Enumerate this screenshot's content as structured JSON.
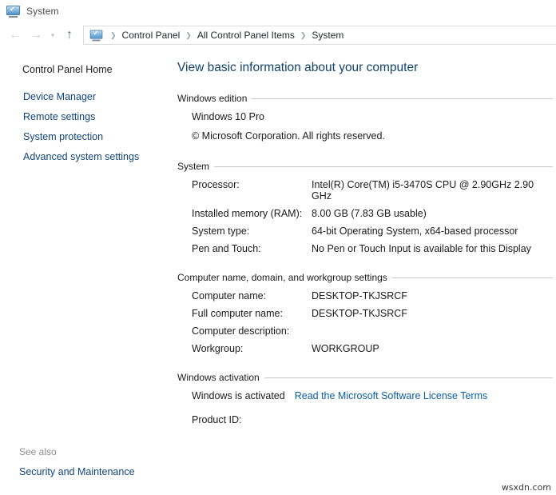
{
  "window": {
    "title": "System",
    "icon": "system-monitor-check-icon"
  },
  "addressbar": {
    "back_icon": "←",
    "forward_icon": "→",
    "recent_icon": "▾",
    "up_icon": "↑",
    "separator": "❯",
    "crumbs": [
      {
        "label": "Control Panel"
      },
      {
        "label": "All Control Panel Items"
      },
      {
        "label": "System"
      }
    ]
  },
  "sidebar": {
    "home_label": "Control Panel Home",
    "items": [
      {
        "label": "Device Manager",
        "icon": "uac-shield-icon"
      },
      {
        "label": "Remote settings",
        "icon": "uac-shield-icon"
      },
      {
        "label": "System protection",
        "icon": "uac-shield-icon"
      },
      {
        "label": "Advanced system settings",
        "icon": "uac-shield-icon"
      }
    ],
    "see_also": {
      "title": "See also",
      "links": [
        {
          "label": "Security and Maintenance"
        }
      ]
    }
  },
  "main": {
    "page_title": "View basic information about your computer",
    "sections": {
      "windows_edition": {
        "heading": "Windows edition",
        "edition": "Windows 10 Pro",
        "copyright": "© Microsoft Corporation. All rights reserved."
      },
      "system": {
        "heading": "System",
        "rows": [
          {
            "label": "Processor:",
            "value": "Intel(R) Core(TM) i5-3470S CPU @ 2.90GHz   2.90 GHz"
          },
          {
            "label": "Installed memory (RAM):",
            "value": "8.00 GB (7.83 GB usable)"
          },
          {
            "label": "System type:",
            "value": "64-bit Operating System, x64-based processor"
          },
          {
            "label": "Pen and Touch:",
            "value": "No Pen or Touch Input is available for this Display"
          }
        ]
      },
      "computer_name": {
        "heading": "Computer name, domain, and workgroup settings",
        "rows": [
          {
            "label": "Computer name:",
            "value": "DESKTOP-TKJSRCF"
          },
          {
            "label": "Full computer name:",
            "value": "DESKTOP-TKJSRCF"
          },
          {
            "label": "Computer description:",
            "value": ""
          },
          {
            "label": "Workgroup:",
            "value": "WORKGROUP"
          }
        ]
      },
      "activation": {
        "heading": "Windows activation",
        "status": "Windows is activated",
        "license_link": "Read the Microsoft Software License Terms",
        "product_id_label": "Product ID:",
        "product_id_value": ""
      }
    }
  },
  "watermark": "wsxdn.com",
  "colors": {
    "link": "#10437c",
    "page_title": "#12426b",
    "activation_link": "#0b5fa4",
    "rule": "#c8c8c8",
    "muted": "#8d8d8d",
    "background": "#ffffff"
  }
}
